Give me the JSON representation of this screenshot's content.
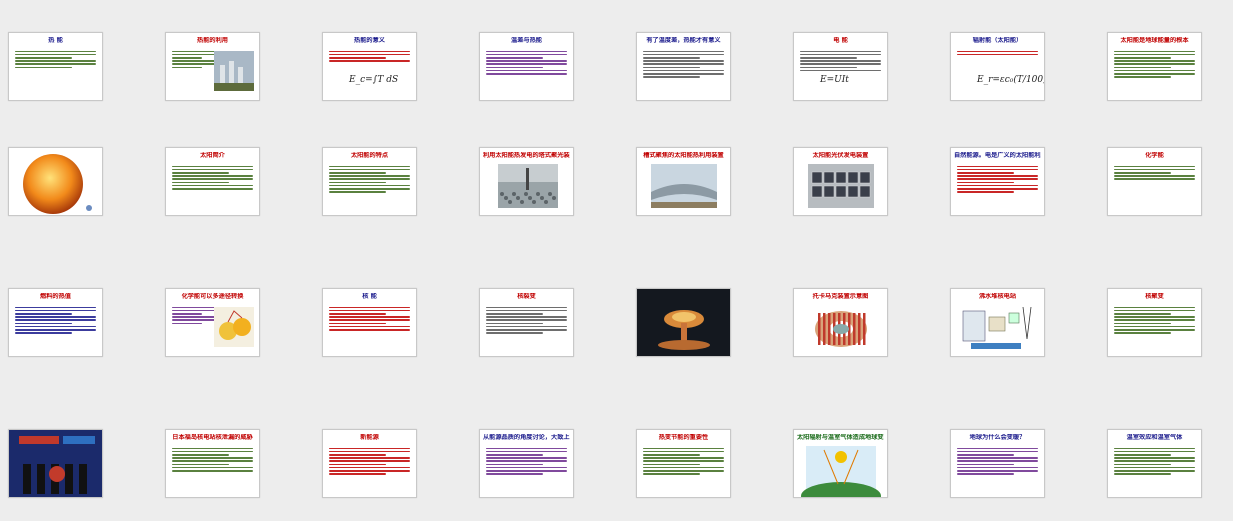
{
  "slides": [
    {
      "title": "热 能",
      "title_color": "#1a1a8c",
      "line_color": "#3d6b1d",
      "type": "text",
      "lines": 6
    },
    {
      "title": "热能的利用",
      "title_color": "#c00000",
      "line_color": "#3d6b1d",
      "type": "text-img",
      "img": "factory-image",
      "lines": 6
    },
    {
      "title": "热能的意义",
      "title_color": "#1a1a8c",
      "line_color": "#c00000",
      "type": "text-formula",
      "formula": "E_c=∫T dS",
      "lines": 4
    },
    {
      "title": "温差与热能",
      "title_color": "#1a1a8c",
      "line_color": "#6a2a8c",
      "type": "text",
      "lines": 8
    },
    {
      "title": "有了温度差，热能才有意义",
      "title_color": "#1a1a8c",
      "line_color": "#555",
      "type": "text",
      "lines": 9
    },
    {
      "title": "电 能",
      "title_color": "#c00000",
      "line_color": "#555",
      "type": "text-formula",
      "formula": "E=UIt",
      "lines": 7
    },
    {
      "title": "辐射能（太阳能）",
      "title_color": "#1a1a8c",
      "line_color": "#c00000",
      "type": "text-formula",
      "formula": "E_r=εc₀(T/100)⁴",
      "lines": 2
    },
    {
      "title": "太阳能是地球能量的根本",
      "title_color": "#c00000",
      "line_color": "#3d6b1d",
      "type": "text",
      "lines": 9
    },
    {
      "title": "",
      "title_color": "#000",
      "line_color": "#000",
      "type": "sun",
      "lines": 0
    },
    {
      "title": "太阳简介",
      "title_color": "#c00000",
      "line_color": "#3d6b1d",
      "type": "text",
      "lines": 8
    },
    {
      "title": "太阳能的特点",
      "title_color": "#c00000",
      "line_color": "#3d6b1d",
      "type": "text",
      "lines": 9
    },
    {
      "title": "利用太阳能热发电的塔式聚光装置",
      "title_color": "#c00000",
      "line_color": "#000",
      "type": "img",
      "img": "tower-image",
      "lines": 0
    },
    {
      "title": "槽式聚焦的太阳能热利用装置",
      "title_color": "#c00000",
      "line_color": "#000",
      "type": "img",
      "img": "trough-image",
      "lines": 0
    },
    {
      "title": "太阳能光伏发电装置",
      "title_color": "#c00000",
      "line_color": "#000",
      "type": "img",
      "img": "pv-image",
      "lines": 0
    },
    {
      "title": "自然能源。电是广义的太阳能利用形式",
      "title_color": "#1a1a8c",
      "line_color": "#c00000",
      "type": "text",
      "lines": 9
    },
    {
      "title": "化学能",
      "title_color": "#c00000",
      "line_color": "#3d6b1d",
      "type": "text",
      "lines": 5
    },
    {
      "title": "燃料的热值",
      "title_color": "#c00000",
      "line_color": "#1a1a8c",
      "type": "text",
      "lines": 9
    },
    {
      "title": "化学能可以多途径转换",
      "title_color": "#c00000",
      "line_color": "#6a2a8c",
      "type": "text-img",
      "img": "lemon-battery-image",
      "lines": 6
    },
    {
      "title": "核 能",
      "title_color": "#1a1a8c",
      "line_color": "#c00000",
      "type": "text",
      "lines": 8
    },
    {
      "title": "核裂变",
      "title_color": "#c00000",
      "line_color": "#555",
      "type": "text",
      "lines": 9
    },
    {
      "title": "",
      "title_color": "#000",
      "line_color": "#000",
      "type": "explosion",
      "lines": 0
    },
    {
      "title": "托卡马克装置示意图",
      "title_color": "#c00000",
      "line_color": "#000",
      "type": "img",
      "img": "tokamak-image",
      "lines": 0
    },
    {
      "title": "沸水堆核电站",
      "title_color": "#c00000",
      "line_color": "#000",
      "type": "img",
      "img": "reactor-diagram",
      "lines": 0
    },
    {
      "title": "核聚变",
      "title_color": "#c00000",
      "line_color": "#3d6b1d",
      "type": "text",
      "lines": 9
    },
    {
      "title": "",
      "title_color": "#000",
      "line_color": "#000",
      "type": "photo",
      "lines": 0
    },
    {
      "title": "日本福岛核电站核泄漏的威胁",
      "title_color": "#c00000",
      "line_color": "#3d6b1d",
      "type": "text",
      "lines": 8
    },
    {
      "title": "新能源",
      "title_color": "#c00000",
      "line_color": "#c00000",
      "type": "text",
      "lines": 9
    },
    {
      "title": "从能源品质的角度讨论，大致上能源划分为：",
      "title_color": "#1a1a8c",
      "line_color": "#6a2a8c",
      "type": "text",
      "lines": 9
    },
    {
      "title": "热变节能的重要性",
      "title_color": "#c00000",
      "line_color": "#3d6b1d",
      "type": "text",
      "lines": 9
    },
    {
      "title": "太阳辐射与温室气体造成地球变暖示意图",
      "title_color": "#1a6b1a",
      "line_color": "#000",
      "type": "img",
      "img": "greenhouse-diagram",
      "lines": 0
    },
    {
      "title": "地球为什么会变暖？",
      "title_color": "#1a1a8c",
      "line_color": "#6a2a8c",
      "type": "text",
      "lines": 9
    },
    {
      "title": "温室效应和温室气体",
      "title_color": "#1a1a8c",
      "line_color": "#3d6b1d",
      "type": "text",
      "lines": 9
    }
  ]
}
